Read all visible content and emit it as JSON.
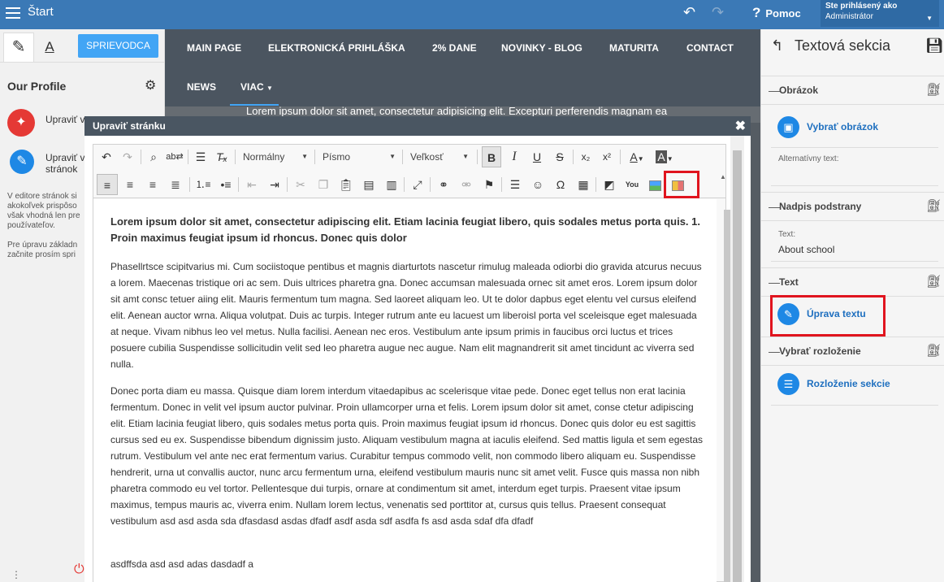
{
  "topbar": {
    "start_label": "Štart",
    "help_label": "Pomoc",
    "user_line1": "Ste prihlásený ako",
    "user_line2": "Administrátor"
  },
  "left_panel": {
    "guide_button": "SPRIEVODCA",
    "profile_title": "Our Profile",
    "items": [
      {
        "label": "Upraviť v",
        "color": "#e53935"
      },
      {
        "label": "Upraviť v stránok",
        "color": "#1e88e5"
      }
    ],
    "note1": "V editore stránok si akokoľvek prispôso však vhodná len pre používateľov.",
    "note2": "Pre úpravu základn začnite prosím spri"
  },
  "site": {
    "nav": [
      "MAIN PAGE",
      "ELEKTRONICKÁ PRIHLÁŠKA",
      "2% DANE",
      "NOVINKY - BLOG",
      "MATURITA",
      "CONTACT",
      "NEWS",
      "VIAC"
    ],
    "hero_text": "Lorem ipsum dolor sit amet, consectetur adipisicing elit. Excepturi perferendis magnam ea"
  },
  "modal": {
    "title": "Upraviť stránku",
    "format_combo": "Normálny",
    "font_combo": "Písmo",
    "size_combo": "Veľkosť",
    "paragraphs": [
      "Lorem ipsum dolor sit amet, consectetur adipiscing elit. Etiam lacinia feugiat libero, quis sodales metus porta quis. 1. Proin maximus feugiat ipsum id rhoncus. Donec quis dolor",
      "Phasellrtsce scipitvarius mi. Cum sociistoque pentibus et magnis diarturtots nascetur rimulug maleada odiorbi dio gravida atcurus necuus a lorem. Maecenas tristique ori ac sem. Duis ultrices pharetra gna. Donec accumsan malesuada ornec sit amet eros. Lorem ipsum dolor sit amt consc tetuer aiing elit. Mauris fermentum tum magna. Sed laoreet aliquam leo. Ut te dolor dapbus eget elentu vel cursus eleifend elit. Aenean auctor wrna. Aliqua volutpat. Duis ac turpis. Integer rutrum ante eu lacuest um liberoisl porta vel sceleisque eget malesuada at neque. Vivam nibhus leo vel metus. Nulla facilisi. Aenean nec eros. Vestibulum ante ipsum primis in faucibus orci luctus et trices posuere cubilia Suspendisse sollicitudin velit sed leo pharetra augue nec augue. Nam elit magnandrerit sit amet tincidunt ac viverra sed nulla.",
      "Donec porta diam eu massa. Quisque diam lorem interdum vitaedapibus ac scelerisque vitae pede. Donec eget tellus non erat lacinia fermentum. Donec in velit vel ipsum auctor pulvinar. Proin ullamcorper urna et felis. Lorem ipsum dolor sit amet, conse ctetur adipiscing elit. Etiam lacinia feugiat libero, quis sodales metus porta quis. Proin maximus feugiat ipsum id rhoncus. Donec quis dolor eu est sagittis cursus sed eu ex. Suspendisse bibendum dignissim justo. Aliquam vestibulum magna at iaculis eleifend. Sed mattis ligula et sem egestas rutrum. Vestibulum vel ante nec erat fermentum varius. Curabitur tempus commodo velit, non commodo libero aliquam eu. Suspendisse hendrerit, urna ut convallis auctor, nunc arcu fermentum urna, eleifend vestibulum mauris nunc sit amet velit. Fusce quis massa non nibh pharetra commodo eu vel tortor. Pellentesque dui turpis, ornare at condimentum sit amet, interdum eget turpis. Praesent vitae ipsum maximus, tempus mauris ac, viverra enim. Nullam lorem lectus, venenatis sed porttitor at, cursus quis tellus. Praesent consequat vestibulum asd asd asda sda dfasdasd asdas dfadf asdf asda sdf asdfa fs asd asda sdaf dfa dfadf",
      "asdffsda asd asd adas dasdadf a"
    ]
  },
  "right_panel": {
    "title": "Textová sekcia",
    "sections": {
      "image": "Obrázok",
      "subheading": "Nadpis podstrany",
      "text": "Text",
      "layout": "Vybrať rozloženie"
    },
    "select_image": "Vybrať obrázok",
    "alt_text_label": "Alternatívny text:",
    "text_label": "Text:",
    "subheading_value": "About school",
    "edit_text": "Úprava textu",
    "section_layout": "Rozloženie sekcie"
  },
  "colors": {
    "topbar": "#3b79b6",
    "accent": "#1e88e5",
    "highlight": "#e0141e",
    "modal_header": "#4a5662"
  }
}
